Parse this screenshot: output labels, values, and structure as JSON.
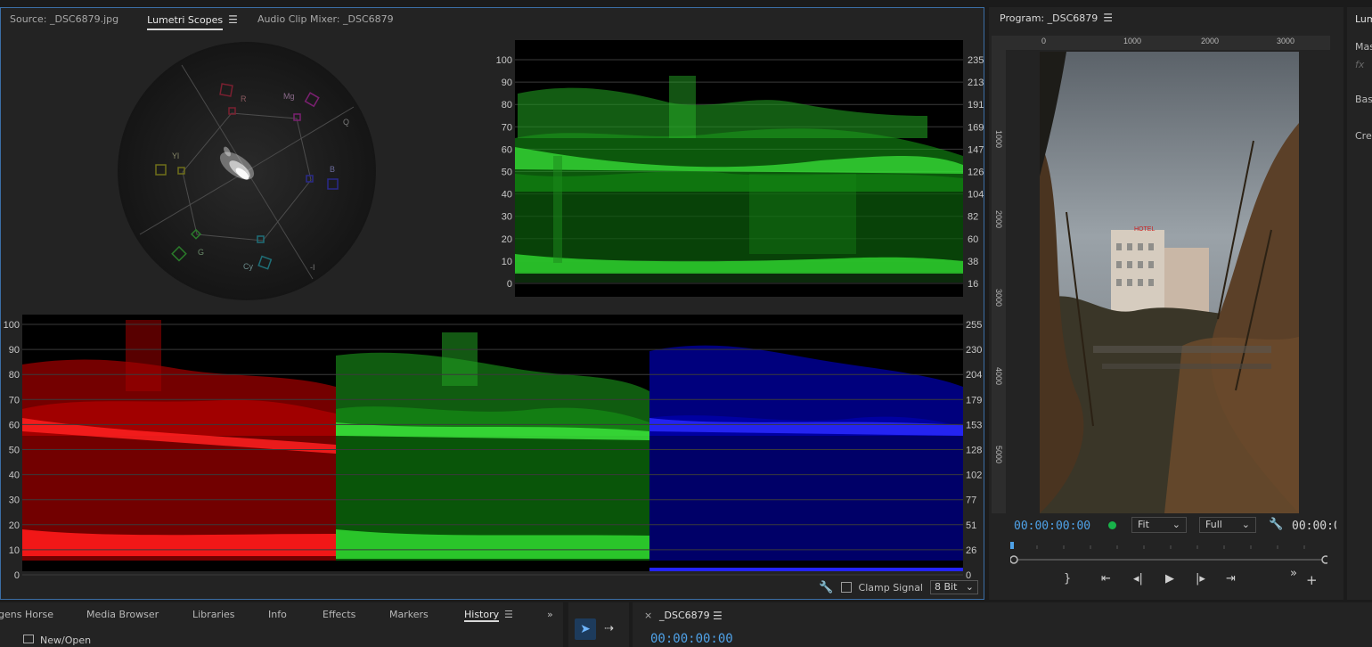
{
  "scopes_panel": {
    "tabs": [
      {
        "label": "Source: _DSC6879.jpg"
      },
      {
        "label": "Lumetri Scopes",
        "active": true
      },
      {
        "label": "Audio Clip Mixer: _DSC6879"
      }
    ],
    "vectorscope": {
      "targets": [
        "R",
        "Mg",
        "B",
        "Cy",
        "G",
        "Yl",
        "Q",
        "-I"
      ]
    },
    "luma_waveform": {
      "left_scale": [
        "100",
        "90",
        "80",
        "70",
        "60",
        "50",
        "40",
        "30",
        "20",
        "10",
        "0"
      ],
      "right_scale": [
        "235",
        "213",
        "191",
        "169",
        "147",
        "126",
        "104",
        "82",
        "60",
        "38",
        "16"
      ]
    },
    "rgb_parade": {
      "left_scale": [
        "100",
        "90",
        "80",
        "70",
        "60",
        "50",
        "40",
        "30",
        "20",
        "10",
        "0"
      ],
      "right_scale": [
        "255",
        "230",
        "204",
        "179",
        "153",
        "128",
        "102",
        "77",
        "51",
        "26",
        "0"
      ]
    },
    "footer": {
      "clamp_label": "Clamp Signal",
      "bit_depth": "8 Bit",
      "wrench_icon": "wrench-icon"
    }
  },
  "program_monitor": {
    "title": "Program: _DSC6879",
    "ruler": [
      "0",
      "1000",
      "2000",
      "3000"
    ],
    "vruler": [
      "1000",
      "2000",
      "3000",
      "4000",
      "5000"
    ],
    "timecode": "00:00:00:00",
    "timecode_right": "00:00:0",
    "fit": "Fit",
    "quality": "Full",
    "photo_sign": "HOTEL"
  },
  "right_panel": {
    "items": [
      "Lum",
      "Mas",
      "fx",
      "Bas",
      "Cre"
    ]
  },
  "bottom_panel": {
    "tabs": [
      "gens Horse",
      "Media Browser",
      "Libraries",
      "Info",
      "Effects",
      "Markers",
      "History"
    ],
    "active_tab": "History",
    "history_item": "New/Open"
  },
  "timeline": {
    "sequence_name": "_DSC6879",
    "timecode": "00:00:00:00"
  }
}
